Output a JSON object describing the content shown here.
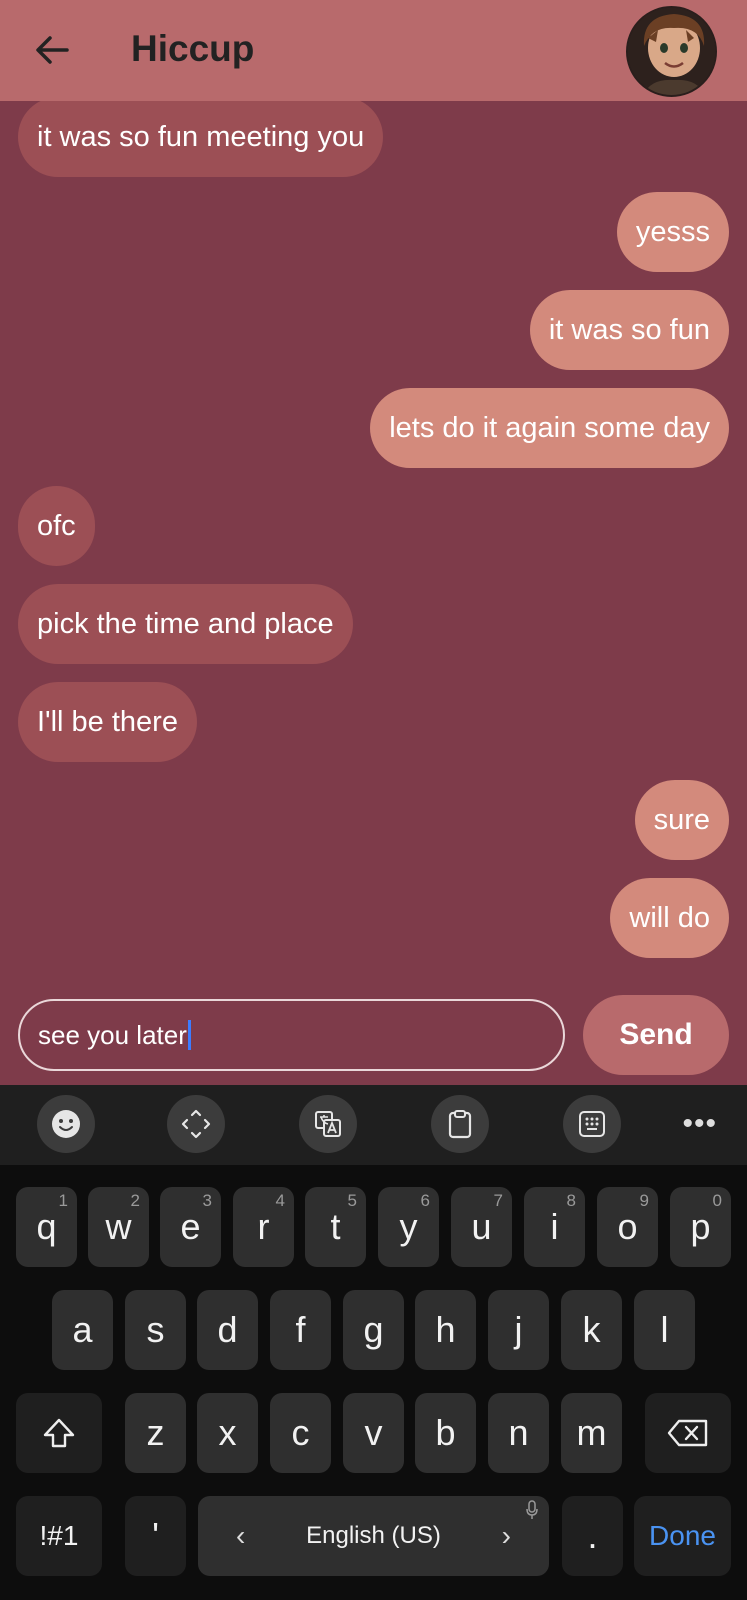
{
  "header": {
    "title": "Hiccup",
    "back_icon": "arrow-left-icon"
  },
  "messages": [
    {
      "side": "in",
      "text": "it was so fun meeting you"
    },
    {
      "side": "out",
      "text": "yesss"
    },
    {
      "side": "out",
      "text": "it was so fun"
    },
    {
      "side": "out",
      "text": "lets do it again some day"
    },
    {
      "side": "in",
      "text": "ofc"
    },
    {
      "side": "in",
      "text": "pick the time and place"
    },
    {
      "side": "in",
      "text": "I'll be there"
    },
    {
      "side": "out",
      "text": "sure"
    },
    {
      "side": "out",
      "text": "will do"
    }
  ],
  "composer": {
    "value": "see you later",
    "send_label": "Send"
  },
  "keyboard": {
    "toolbar_icons": [
      "emoji-icon",
      "cursor-move-icon",
      "translate-icon",
      "clipboard-icon",
      "keypad-icon",
      "more-icon"
    ],
    "row1": [
      {
        "key": "q",
        "hint": "1"
      },
      {
        "key": "w",
        "hint": "2"
      },
      {
        "key": "e",
        "hint": "3"
      },
      {
        "key": "r",
        "hint": "4"
      },
      {
        "key": "t",
        "hint": "5"
      },
      {
        "key": "y",
        "hint": "6"
      },
      {
        "key": "u",
        "hint": "7"
      },
      {
        "key": "i",
        "hint": "8"
      },
      {
        "key": "o",
        "hint": "9"
      },
      {
        "key": "p",
        "hint": "0"
      }
    ],
    "row2": [
      "a",
      "s",
      "d",
      "f",
      "g",
      "h",
      "j",
      "k",
      "l"
    ],
    "row3": [
      "z",
      "x",
      "c",
      "v",
      "b",
      "n",
      "m"
    ],
    "symbols_label": "!#1",
    "apostrophe": "'",
    "language": "English (US)",
    "period": ".",
    "done_label": "Done"
  },
  "colors": {
    "background": "#7e3b4a",
    "header": "#b86a6c",
    "incoming_bubble": "#9c4f55",
    "outgoing_bubble": "#d38a7c",
    "done_accent": "#4a93f2"
  }
}
